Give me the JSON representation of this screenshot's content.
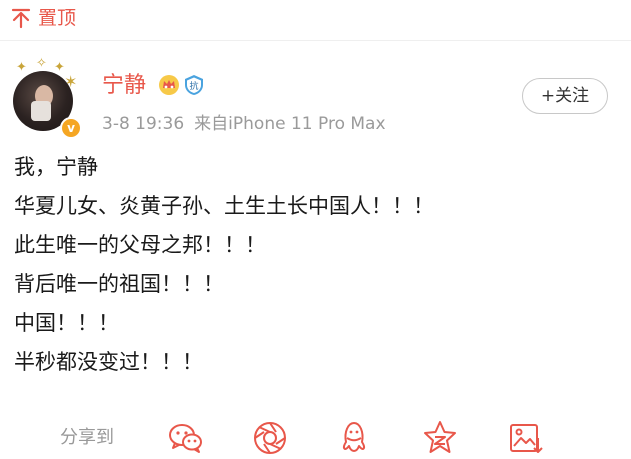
{
  "pin": {
    "label": "置顶"
  },
  "profile": {
    "name": "宁静",
    "date": "3-8 19:36",
    "source": "来自iPhone 11 Pro Max",
    "shield_badge_text": "抗"
  },
  "follow_button": {
    "label": "+关注"
  },
  "post": {
    "lines": [
      "我，宁静",
      "华夏儿女、炎黄子孙、土生土长中国人！！！",
      "此生唯一的父母之邦！！！",
      "背后唯一的祖国！！！",
      "中国！！！",
      "半秒都没变过！！！"
    ]
  },
  "share": {
    "label": "分享到",
    "targets": [
      "wechat-icon",
      "moments-icon",
      "qq-icon",
      "qzone-icon",
      "save-image-icon"
    ]
  },
  "colors": {
    "accent": "#e8574a",
    "gold": "#f5a623",
    "grey": "#999999"
  }
}
